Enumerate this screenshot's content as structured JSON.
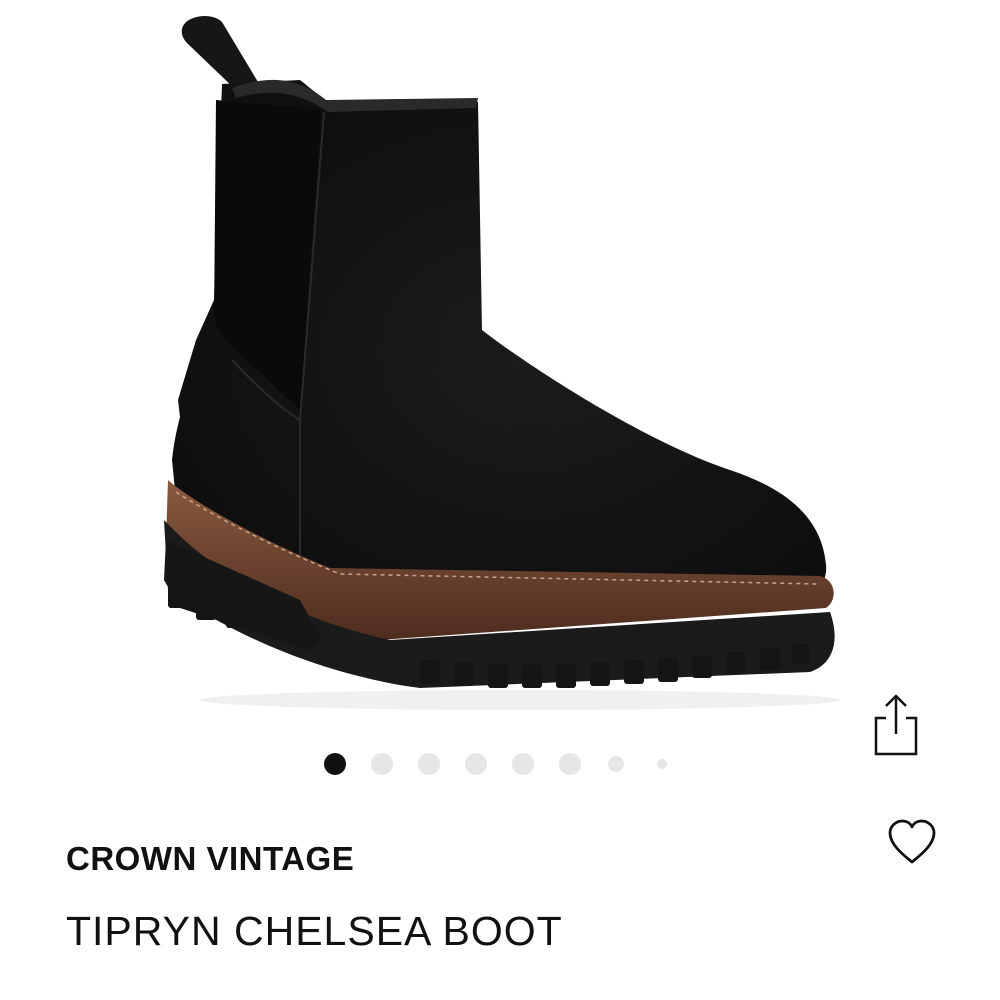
{
  "product": {
    "brand": "CROWN VINTAGE",
    "name": "TIPRYN CHELSEA BOOT",
    "image": {
      "subject": "black suede chelsea boot with brown welt and black lug sole"
    }
  },
  "carousel": {
    "total_dots": 8,
    "active_index": 0
  },
  "icons": {
    "share": "share-icon",
    "favorite": "heart-icon"
  },
  "colors": {
    "text": "#111111",
    "dot_active": "#111111",
    "dot_inactive": "#e6e6e6",
    "boot_body": "#141414",
    "welt": "#6b3f2a",
    "sole": "#1b1b1b"
  }
}
